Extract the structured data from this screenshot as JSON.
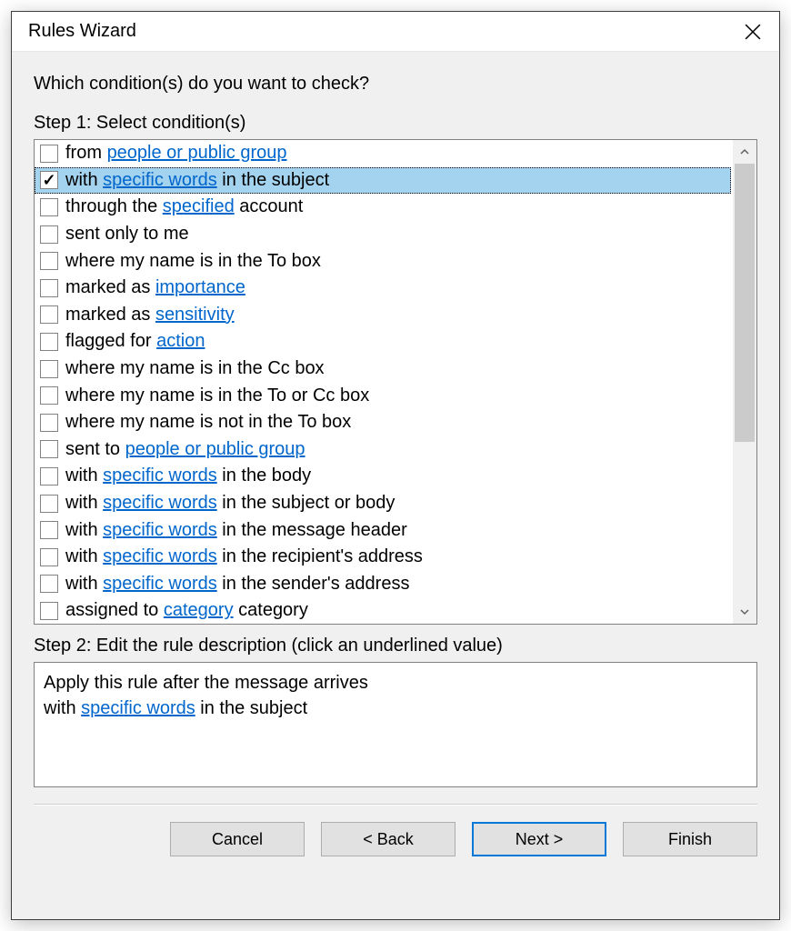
{
  "window": {
    "title": "Rules Wizard"
  },
  "heading": "Which condition(s) do you want to check?",
  "step1_label": "Step 1: Select condition(s)",
  "step2_label": "Step 2: Edit the rule description (click an underlined value)",
  "conditions": [
    {
      "checked": false,
      "selected": false,
      "parts": [
        {
          "t": "from "
        },
        {
          "t": "people or public group",
          "link": true
        }
      ]
    },
    {
      "checked": true,
      "selected": true,
      "parts": [
        {
          "t": "with "
        },
        {
          "t": "specific words",
          "link": true
        },
        {
          "t": " in the subject"
        }
      ]
    },
    {
      "checked": false,
      "selected": false,
      "parts": [
        {
          "t": "through the "
        },
        {
          "t": "specified",
          "link": true
        },
        {
          "t": " account"
        }
      ]
    },
    {
      "checked": false,
      "selected": false,
      "parts": [
        {
          "t": "sent only to me"
        }
      ]
    },
    {
      "checked": false,
      "selected": false,
      "parts": [
        {
          "t": "where my name is in the To box"
        }
      ]
    },
    {
      "checked": false,
      "selected": false,
      "parts": [
        {
          "t": "marked as "
        },
        {
          "t": "importance",
          "link": true
        }
      ]
    },
    {
      "checked": false,
      "selected": false,
      "parts": [
        {
          "t": "marked as "
        },
        {
          "t": "sensitivity",
          "link": true
        }
      ]
    },
    {
      "checked": false,
      "selected": false,
      "parts": [
        {
          "t": "flagged for "
        },
        {
          "t": "action",
          "link": true
        }
      ]
    },
    {
      "checked": false,
      "selected": false,
      "parts": [
        {
          "t": "where my name is in the Cc box"
        }
      ]
    },
    {
      "checked": false,
      "selected": false,
      "parts": [
        {
          "t": "where my name is in the To or Cc box"
        }
      ]
    },
    {
      "checked": false,
      "selected": false,
      "parts": [
        {
          "t": "where my name is not in the To box"
        }
      ]
    },
    {
      "checked": false,
      "selected": false,
      "parts": [
        {
          "t": "sent to "
        },
        {
          "t": "people or public group",
          "link": true
        }
      ]
    },
    {
      "checked": false,
      "selected": false,
      "parts": [
        {
          "t": "with "
        },
        {
          "t": "specific words",
          "link": true
        },
        {
          "t": " in the body"
        }
      ]
    },
    {
      "checked": false,
      "selected": false,
      "parts": [
        {
          "t": "with "
        },
        {
          "t": "specific words",
          "link": true
        },
        {
          "t": " in the subject or body"
        }
      ]
    },
    {
      "checked": false,
      "selected": false,
      "parts": [
        {
          "t": "with "
        },
        {
          "t": "specific words",
          "link": true
        },
        {
          "t": " in the message header"
        }
      ]
    },
    {
      "checked": false,
      "selected": false,
      "parts": [
        {
          "t": "with "
        },
        {
          "t": "specific words",
          "link": true
        },
        {
          "t": " in the recipient's address"
        }
      ]
    },
    {
      "checked": false,
      "selected": false,
      "parts": [
        {
          "t": "with "
        },
        {
          "t": "specific words",
          "link": true
        },
        {
          "t": " in the sender's address"
        }
      ]
    },
    {
      "checked": false,
      "selected": false,
      "parts": [
        {
          "t": "assigned to "
        },
        {
          "t": "category",
          "link": true
        },
        {
          "t": " category"
        }
      ]
    }
  ],
  "description_lines": [
    [
      {
        "t": "Apply this rule after the message arrives"
      }
    ],
    [
      {
        "t": "with "
      },
      {
        "t": "specific words",
        "link": true
      },
      {
        "t": " in the subject"
      }
    ]
  ],
  "buttons": {
    "cancel": "Cancel",
    "back": "< Back",
    "next": "Next >",
    "finish": "Finish"
  }
}
